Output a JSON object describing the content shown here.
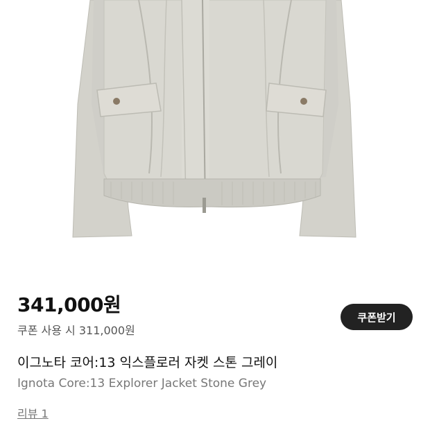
{
  "product": {
    "image_alt": "jacket-photo",
    "price": "341,000원",
    "coupon_price_text": "쿠폰 사용 시 311,000원",
    "coupon_button_label": "쿠폰받기",
    "title_ko": "이그노타 코어:13 익스플로러 자켓 스톤 그레이",
    "title_en": "Ignota Core:13 Explorer Jacket Stone Grey",
    "review_link": "리뷰 1"
  },
  "colors": {
    "jacket": "#d4d3cc",
    "button_bg": "#222222",
    "price_text": "#111111",
    "sub_text": "#777777"
  }
}
